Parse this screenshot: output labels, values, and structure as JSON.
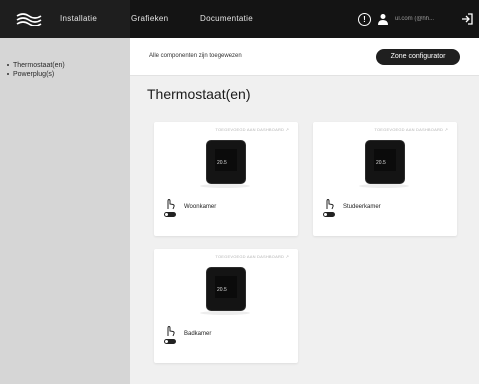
{
  "colors": {
    "topbar": "#141414",
    "sidebar": "#d6d6d6",
    "content": "#f0f0f0",
    "button": "#1f1f1f"
  },
  "header": {
    "logo_icon": "waves-logo-icon",
    "nav": [
      {
        "label": "Installatie"
      },
      {
        "label": "Grafieken"
      },
      {
        "label": "Documentatie"
      }
    ],
    "info_icon": "info-icon",
    "user_icon": "user-icon",
    "user_name": "ul.com (@hh...",
    "logout_icon": "logout-icon"
  },
  "sidebar": {
    "items": [
      {
        "label": "Thermostaat(en)"
      },
      {
        "label": "Powerplug(s)"
      }
    ]
  },
  "main": {
    "banner_text": "Alle componenten zijn toegewezen",
    "zone_button_label": "Zone configurator",
    "title": "Thermostaat(en)",
    "cards": [
      {
        "link": "TOEGEVOEGD AAN DASHBOARD ↗",
        "name": "Woonkamer",
        "temp": "20.5"
      },
      {
        "link": "TOEGEVOEGD AAN DASHBOARD ↗",
        "name": "Studeerkamer",
        "temp": "20.5"
      },
      {
        "link": "TOEGEVOEGD AAN DASHBOARD ↗",
        "name": "Badkamer",
        "temp": "20.5"
      }
    ]
  }
}
